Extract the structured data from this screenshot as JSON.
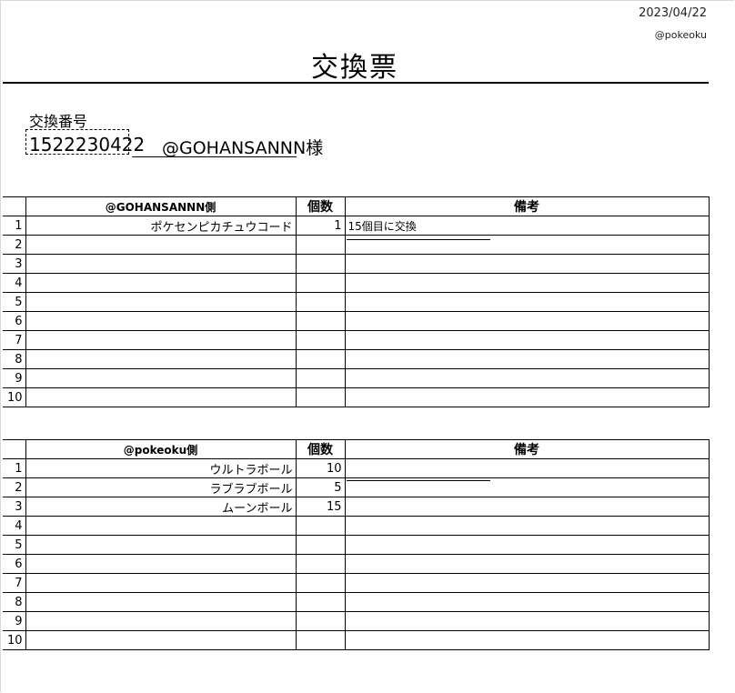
{
  "header": {
    "date": "2023/04/22",
    "owner": "@pokeoku",
    "title": "交換票",
    "number_label": "交換番号",
    "number_value": "1522230422",
    "customer": "@GOHANSANNN様"
  },
  "table1": {
    "col_name": "@GOHANSANNN側",
    "col_qty": "個数",
    "col_note": "備考",
    "rows": [
      {
        "no": "1",
        "item": "ポケセンピカチュウコード",
        "qty": "1",
        "note": "15個目に交換"
      },
      {
        "no": "2",
        "item": "",
        "qty": "",
        "note": ""
      },
      {
        "no": "3",
        "item": "",
        "qty": "",
        "note": ""
      },
      {
        "no": "4",
        "item": "",
        "qty": "",
        "note": ""
      },
      {
        "no": "5",
        "item": "",
        "qty": "",
        "note": ""
      },
      {
        "no": "6",
        "item": "",
        "qty": "",
        "note": ""
      },
      {
        "no": "7",
        "item": "",
        "qty": "",
        "note": ""
      },
      {
        "no": "8",
        "item": "",
        "qty": "",
        "note": ""
      },
      {
        "no": "9",
        "item": "",
        "qty": "",
        "note": ""
      },
      {
        "no": "10",
        "item": "",
        "qty": "",
        "note": ""
      }
    ]
  },
  "table2": {
    "col_name": "@pokeoku側",
    "col_qty": "個数",
    "col_note": "備考",
    "rows": [
      {
        "no": "1",
        "item": "ウルトラボール",
        "qty": "10",
        "note": ""
      },
      {
        "no": "2",
        "item": "ラブラブボール",
        "qty": "5",
        "note": ""
      },
      {
        "no": "3",
        "item": "ムーンボール",
        "qty": "15",
        "note": ""
      },
      {
        "no": "4",
        "item": "",
        "qty": "",
        "note": ""
      },
      {
        "no": "5",
        "item": "",
        "qty": "",
        "note": ""
      },
      {
        "no": "6",
        "item": "",
        "qty": "",
        "note": ""
      },
      {
        "no": "7",
        "item": "",
        "qty": "",
        "note": ""
      },
      {
        "no": "8",
        "item": "",
        "qty": "",
        "note": ""
      },
      {
        "no": "9",
        "item": "",
        "qty": "",
        "note": ""
      },
      {
        "no": "10",
        "item": "",
        "qty": "",
        "note": ""
      }
    ]
  }
}
